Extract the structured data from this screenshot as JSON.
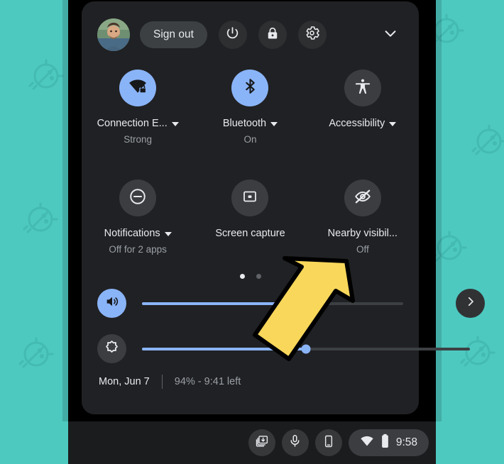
{
  "wallpaper": {
    "color": "#4dc9c0",
    "motif_icon": "android-bot-icon"
  },
  "panel": {
    "background": "#202124",
    "header": {
      "avatar": "user-avatar",
      "sign_out_label": "Sign out",
      "power_icon": "power-icon",
      "lock_icon": "lock-icon",
      "settings_icon": "gear-icon",
      "collapse_icon": "chevron-down-icon"
    },
    "tiles": [
      {
        "name": "network",
        "icon": "wifi-secured-icon",
        "label": "Connection E...",
        "sublabel": "Strong",
        "has_caret": true,
        "active": true
      },
      {
        "name": "bluetooth",
        "icon": "bluetooth-icon",
        "label": "Bluetooth",
        "sublabel": "On",
        "has_caret": true,
        "active": true
      },
      {
        "name": "accessibility",
        "icon": "accessibility-icon",
        "label": "Accessibility",
        "sublabel": "",
        "has_caret": true,
        "active": false
      },
      {
        "name": "notifications",
        "icon": "do-not-disturb-icon",
        "label": "Notifications",
        "sublabel": "Off for 2 apps",
        "has_caret": true,
        "active": false
      },
      {
        "name": "screen-capture",
        "icon": "screen-capture-icon",
        "label": "Screen capture",
        "sublabel": "",
        "has_caret": false,
        "active": false
      },
      {
        "name": "nearby-visibility",
        "icon": "eye-off-icon",
        "label": "Nearby visibil...",
        "sublabel": "Off",
        "has_caret": false,
        "active": false
      }
    ],
    "pagination": {
      "pages": 2,
      "active_page": 1,
      "next_icon": "chevron-right-icon"
    },
    "sliders": [
      {
        "name": "volume",
        "icon": "volume-up-icon",
        "value": 57,
        "active": true
      },
      {
        "name": "brightness",
        "icon": "brightness-icon",
        "value": 50,
        "active": false
      }
    ],
    "footer": {
      "date": "Mon, Jun 7",
      "battery": "94% - 9:41 left"
    }
  },
  "shelf": {
    "buttons": [
      {
        "name": "screen-capture-tray",
        "icon": "screenshot-stack-icon"
      },
      {
        "name": "dictation",
        "icon": "microphone-icon"
      },
      {
        "name": "phone-hub",
        "icon": "phone-icon"
      }
    ],
    "status": {
      "wifi_icon": "wifi-icon",
      "battery_icon": "battery-icon",
      "clock": "9:58"
    }
  },
  "annotation": {
    "type": "arrow",
    "color": "#f9d75a",
    "points_to": "nearby-visibility"
  }
}
